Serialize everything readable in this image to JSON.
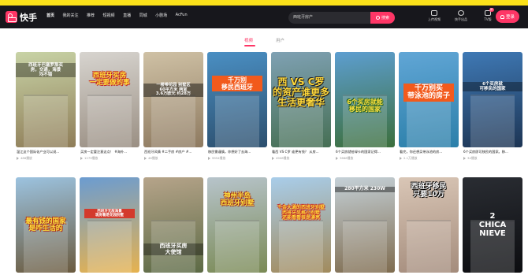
{
  "header": {
    "logo_text": "快手",
    "nav": [
      "首页",
      "我的关注",
      "推荐",
      "短视频",
      "直播",
      "同城",
      "小剧场",
      "AcFun"
    ],
    "search_value": "西班牙房产",
    "search_button": "搜索",
    "tools": [
      {
        "label": "上传视频",
        "icon": "upload-icon"
      },
      {
        "label": "快手出品",
        "icon": "kuaishou-icon"
      },
      {
        "label": "TV版",
        "icon": "tv-icon",
        "badge": "新"
      }
    ],
    "login_label": "登录"
  },
  "tabs": [
    {
      "label": "视频",
      "active": true
    },
    {
      "label": "用户",
      "active": false
    }
  ],
  "videos_row1": [
    {
      "caption": "温江这个国际化产业可以说...",
      "views": "486播放",
      "overlay": [
        "西班牙巴塞罗那买",
        "房，交通，海景",
        "均不错"
      ],
      "colors": [
        "#c8d3a6",
        "#8f7d58"
      ]
    },
    {
      "caption": "买房一定要注意这点！ #海外...",
      "views": "1279播放",
      "overlay": [
        "西班牙买房",
        "一定要做的事"
      ],
      "colors": [
        "#d7d4cf",
        "#9a8f83"
      ]
    },
    {
      "caption": "西班牙风情 #二手房 #房产 #...",
      "views": "46播放",
      "overlay": [
        "一楼带花园 别墅区",
        "60平方米 两室",
        "3.6万欧元 约28万"
      ],
      "colors": [
        "#cfc1a5",
        "#8e7a60"
      ]
    },
    {
      "caption": "移民需谨慎，你想好了去海...",
      "views": "9954播放",
      "overlay": [
        "千万别",
        "移民西班牙"
      ],
      "colors": [
        "#4a8fc3",
        "#2c4f6e"
      ]
    },
    {
      "caption": "看西 VS C罗 谁更有钱？ 从房...",
      "views": "4908播放",
      "overlay": [
        "西 VS C罗",
        "的资产谁更多",
        "生活更奢华"
      ],
      "colors": [
        "#7fa1b3",
        "#466f54"
      ]
    },
    {
      "caption": "6个买房就给绿卡的国家记得...",
      "views": "3668播放",
      "overlay": [
        "6个买房就能",
        "移民的国家"
      ],
      "colors": [
        "#5d9ed0",
        "#3c6f3c"
      ]
    },
    {
      "caption": "看完，你还想买带泳池的房...",
      "views": "2.1万播放",
      "overlay": [
        "千万别买",
        "带泳池的房子"
      ],
      "colors": [
        "#61a6d6",
        "#2b7fa9"
      ]
    },
    {
      "caption": "6个买房即可移民的国家。移...",
      "views": "34播放",
      "overlay": [
        "6个买房就",
        "可移民的国家"
      ],
      "colors": [
        "#3f79b5",
        "#1d3554"
      ]
    }
  ],
  "videos_row2": [
    {
      "overlay": [
        "最有钱的国家",
        "是咋生活的"
      ],
      "colors": [
        "#9cc3e0",
        "#6b5b3f"
      ]
    },
    {
      "overlay": [
        "西班牙无敌海景",
        "现房看是花园别墅"
      ],
      "colors": [
        "#6b9cd1",
        "#e6b24f"
      ]
    },
    {
      "overlay": [
        "西班牙买房",
        "大使馆"
      ],
      "colors": [
        "#b6a48a",
        "#5c6a45"
      ]
    },
    {
      "overlay": [
        "神州半岛",
        "西班牙别墅"
      ],
      "colors": [
        "#b7c4cb",
        "#7a8a55"
      ]
    },
    {
      "overlay": [
        "千金大通的西班牙别墅",
        "西班牙风格小别墅",
        "还能看看很是漂亮"
      ],
      "colors": [
        "#a8cdea",
        "#a28b5d"
      ]
    },
    {
      "overlay": [
        "280平方米 230W"
      ],
      "colors": [
        "#c5d1d8",
        "#7f6c4f"
      ]
    },
    {
      "overlay": [
        "西班牙移民",
        "只要10万"
      ],
      "colors": [
        "#d9c6b6",
        "#a48c7c"
      ]
    },
    {
      "overlay": [
        "2",
        "CHICA",
        "NIEVE"
      ],
      "colors": [
        "#2a2d33",
        "#0c0d10"
      ]
    }
  ]
}
